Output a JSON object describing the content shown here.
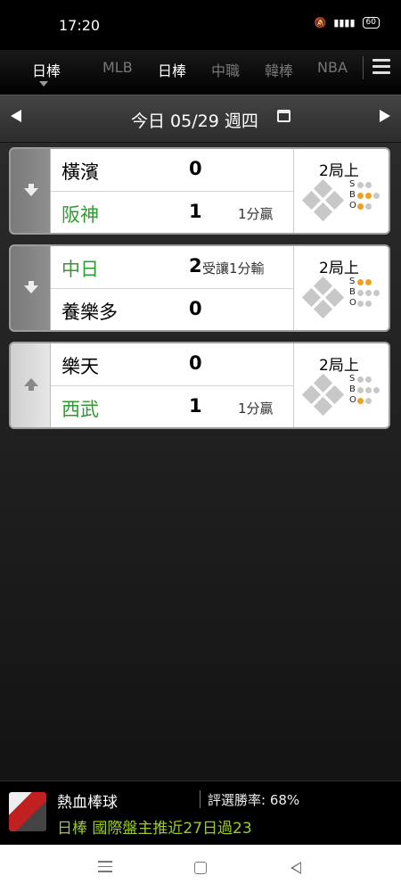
{
  "status_bar": {
    "time": "17:20",
    "battery": "60"
  },
  "nav": {
    "current_label": "日棒",
    "tabs": [
      "MLB",
      "日棒",
      "中職",
      "韓棒",
      "NBA"
    ]
  },
  "date_bar": {
    "text": "今日 05/29 週四"
  },
  "games": [
    {
      "away": {
        "name": "橫濱",
        "score": "0",
        "note": ""
      },
      "home": {
        "name": "阪神",
        "score": "1",
        "note": "1分贏"
      },
      "inning": "2局上",
      "sbo": {
        "S": [
          false,
          false
        ],
        "B": [
          true,
          true,
          false
        ],
        "O": [
          true,
          false
        ]
      }
    },
    {
      "away": {
        "name": "中日",
        "score": "2",
        "note": "受讓1分輸"
      },
      "home": {
        "name": "養樂多",
        "score": "0",
        "note": ""
      },
      "inning": "2局上",
      "sbo": {
        "S": [
          true,
          true
        ],
        "B": [
          false,
          false,
          false
        ],
        "O": [
          false,
          false
        ]
      }
    },
    {
      "away": {
        "name": "樂天",
        "score": "0",
        "note": ""
      },
      "home": {
        "name": "西武",
        "score": "1",
        "note": "1分贏"
      },
      "inning": "2局上",
      "sbo": {
        "S": [
          false,
          false
        ],
        "B": [
          false,
          false,
          false
        ],
        "O": [
          true,
          false
        ]
      }
    }
  ],
  "ad": {
    "title": "熱血棒球",
    "rate": "評選勝率: 68%",
    "message": "日棒 國際盤主推近27日過23"
  },
  "colors": {
    "accent_green": "#2e9b2e",
    "ad_green": "#9ccc2a",
    "sbo_on": "#f0a020"
  },
  "icons": [
    "search-icon"
  ]
}
